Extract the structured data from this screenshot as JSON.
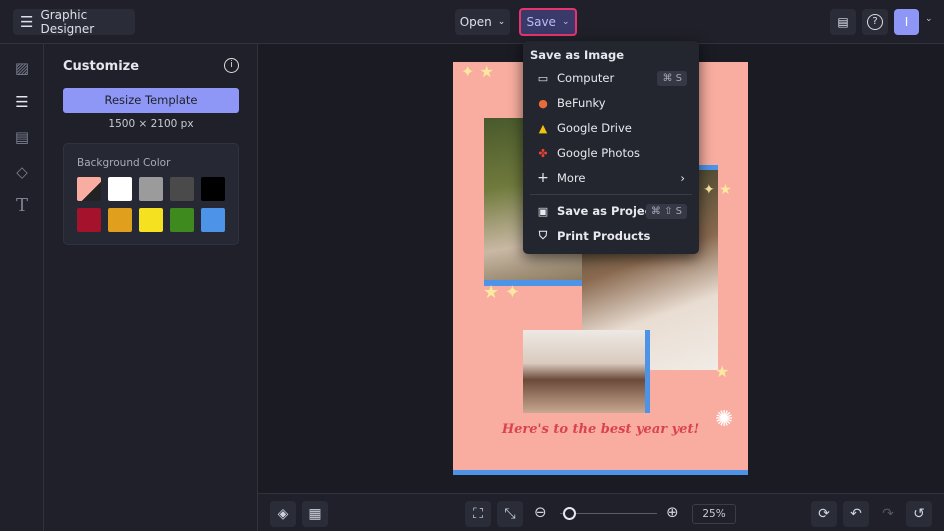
{
  "header": {
    "title": "Graphic Designer",
    "open_label": "Open",
    "save_label": "Save",
    "avatar_initial": "I"
  },
  "panel": {
    "title": "Customize",
    "resize_label": "Resize Template",
    "size_text": "1500 × 2100 px",
    "bg_label": "Background Color",
    "swatches": [
      "#f9ada0",
      "#ffffff",
      "#9b9b9b",
      "#4a4a4a",
      "#000000",
      "#a5122b",
      "#e0a01e",
      "#f5e11f",
      "#3f8a1f",
      "#4d94e8"
    ]
  },
  "save_menu": {
    "heading": "Save as Image",
    "items": [
      {
        "label": "Computer",
        "icon": "monitor-icon",
        "shortcut": "⌘ S"
      },
      {
        "label": "BeFunky",
        "icon": "befunky-icon"
      },
      {
        "label": "Google Drive",
        "icon": "google-drive-icon"
      },
      {
        "label": "Google Photos",
        "icon": "google-photos-icon"
      },
      {
        "label": "More",
        "icon": "plus-icon"
      }
    ],
    "project_label": "Save as Project",
    "project_shortcut": "⌘ ⇧ S",
    "print_label": "Print Products"
  },
  "canvas": {
    "tagline": "Here's to the best year yet!",
    "background": "#f9ada0",
    "accent": "#4d94e8"
  },
  "footer": {
    "zoom": "25%",
    "zoom_fraction": 0.05
  }
}
